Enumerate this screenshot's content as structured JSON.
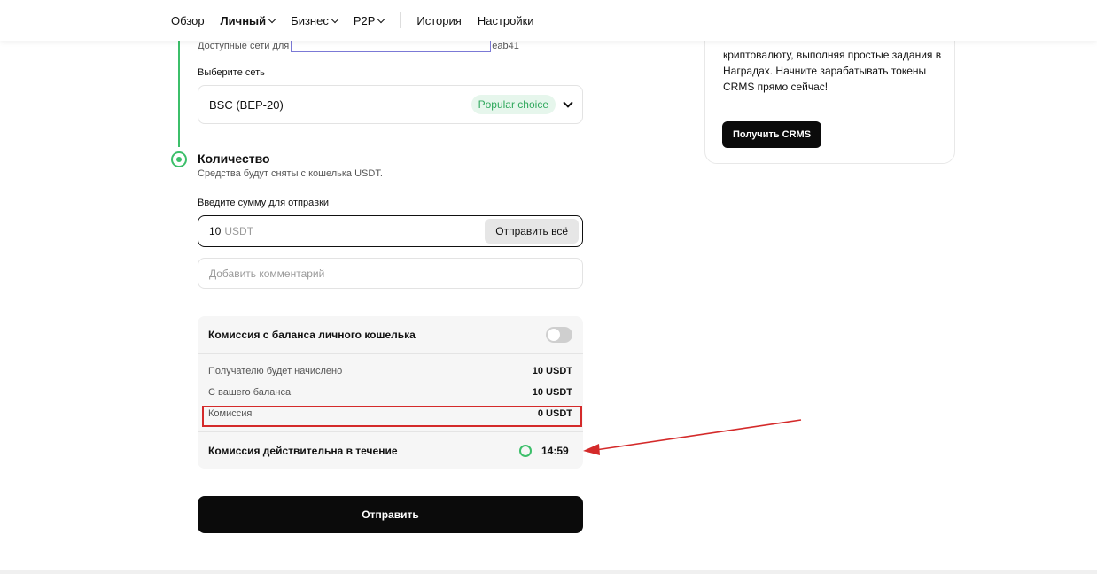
{
  "nav": {
    "items": [
      {
        "label": "Обзор",
        "dropdown": false,
        "active": false
      },
      {
        "label": "Личный",
        "dropdown": true,
        "active": true
      },
      {
        "label": "Бизнес",
        "dropdown": true,
        "active": false
      },
      {
        "label": "P2P",
        "dropdown": true,
        "active": false
      }
    ],
    "history": "История",
    "settings": "Настройки"
  },
  "network": {
    "available_prefix": "Доступные сети для",
    "available_suffix": "eab41",
    "select_label": "Выберите сеть",
    "selected": "BSC (BEP-20)",
    "badge": "Popular choice"
  },
  "amount_section": {
    "title": "Количество",
    "subtitle": "Средства будут сняты с кошелька USDT.",
    "input_label": "Введите сумму для отправки",
    "value": "10",
    "unit": "USDT",
    "send_all": "Отправить всё",
    "comment_placeholder": "Добавить комментарий"
  },
  "fees": {
    "toggle_label": "Комиссия с баланса личного кошелька",
    "toggle_on": false,
    "rows": [
      {
        "label": "Получателю будет начислено",
        "value": "10 USDT"
      },
      {
        "label": "С вашего баланса",
        "value": "10 USDT"
      },
      {
        "label": "Комиссия",
        "value": "0 USDT"
      }
    ],
    "validity_label": "Комиссия действительна в течение",
    "timer": "14:59"
  },
  "submit": "Отправить",
  "promo": {
    "text": "криптовалюту, выполняя простые задания в Наградах. Начните зарабатывать токены CRMS прямо сейчас!",
    "button": "Получить CRMS"
  },
  "colors": {
    "accent_green": "#3cbf6a",
    "annotation_red": "#d42a2a",
    "primary_black": "#0b0b0b"
  }
}
